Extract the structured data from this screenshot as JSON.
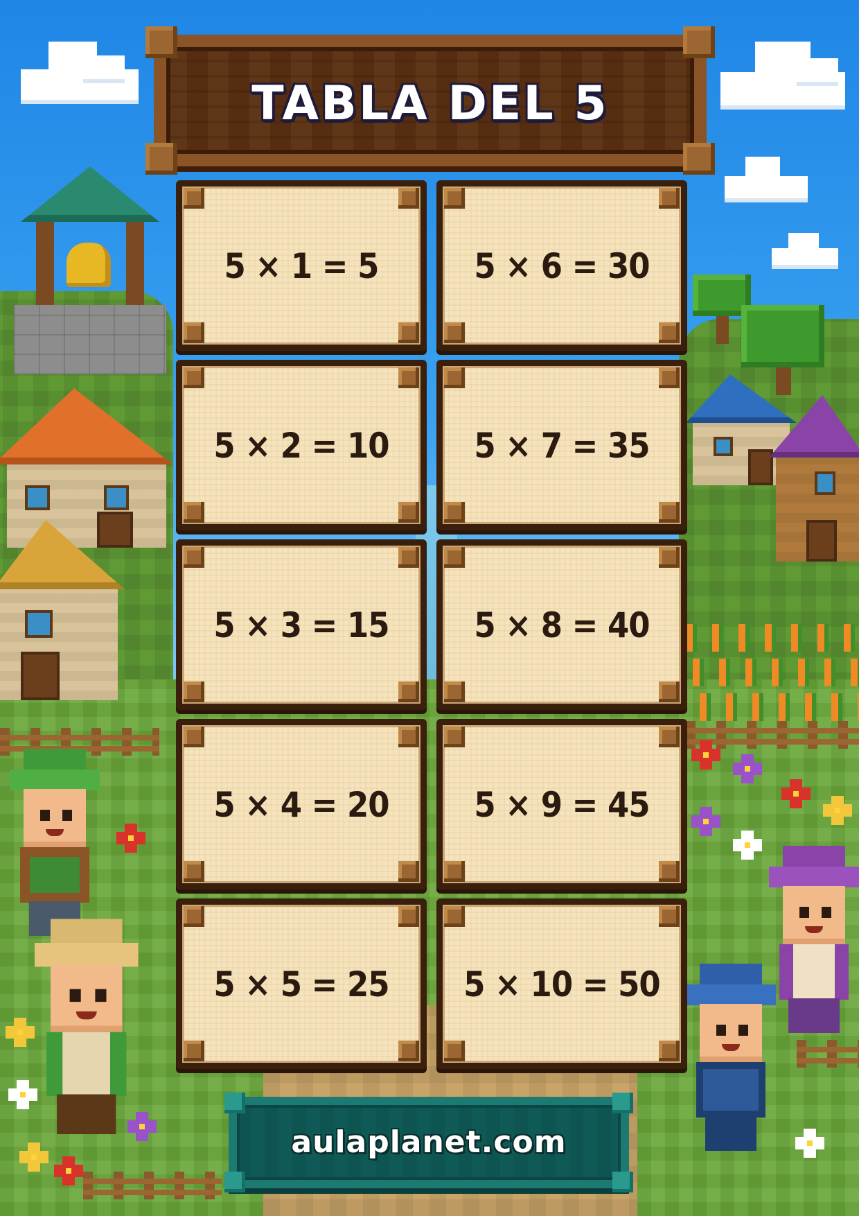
{
  "title": "TABLA DEL 5",
  "table": {
    "left": [
      "5 × 1 = 5",
      "5 × 2 = 10",
      "5 × 3 = 15",
      "5 × 4 = 20",
      "5 × 5 = 25"
    ],
    "right": [
      "5 × 6 = 30",
      "5 × 7 = 35",
      "5 × 8 = 40",
      "5 × 9 = 45",
      "5 × 10 = 50"
    ]
  },
  "footer": "aulaplanet.com",
  "colors": {
    "sky": "#1f86e6",
    "plank": "#5b2f12",
    "card": "#f6e3bb",
    "card_border": "#3a200c",
    "footer_sign": "#0f5a56"
  },
  "scene": {
    "style": "voxel farm village",
    "icons": [
      "cloud-icon",
      "bell-tower-icon",
      "house-icon",
      "tree-icon",
      "fence-icon",
      "carrot-icon",
      "flower-icon",
      "farmer-character-icon"
    ]
  }
}
